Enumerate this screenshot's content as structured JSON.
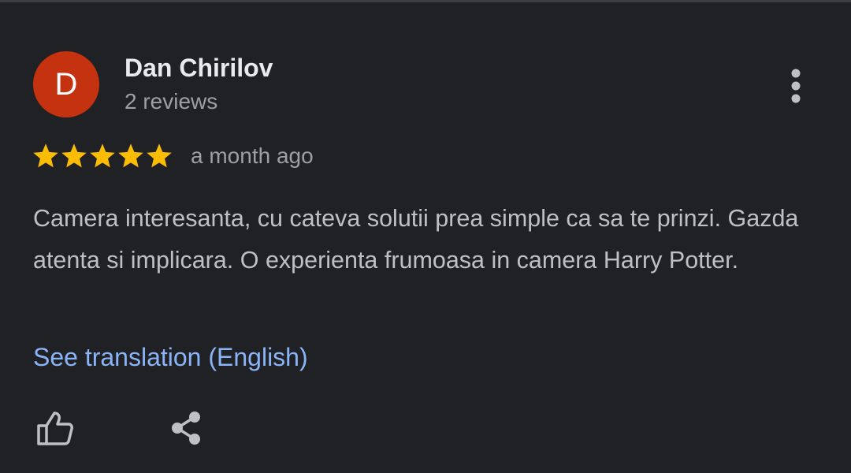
{
  "review": {
    "author": {
      "avatar_letter": "D",
      "avatar_color": "#c5320f",
      "name": "Dan Chirilov",
      "review_count": "2 reviews"
    },
    "rating": 5,
    "rating_max": 5,
    "star_color": "#fbbc04",
    "date": "a month ago",
    "text": "Camera interesanta, cu cateva solutii prea simple ca sa te prinzi. Gazda atenta si implicara. O experienta frumoasa in camera Harry Potter.",
    "translate_link": "See translation (English)",
    "icons": {
      "more": "more-vertical-icon",
      "like": "thumb-up-icon",
      "share": "share-icon"
    }
  },
  "theme": {
    "background": "#202124",
    "link_color": "#8ab4f8"
  }
}
